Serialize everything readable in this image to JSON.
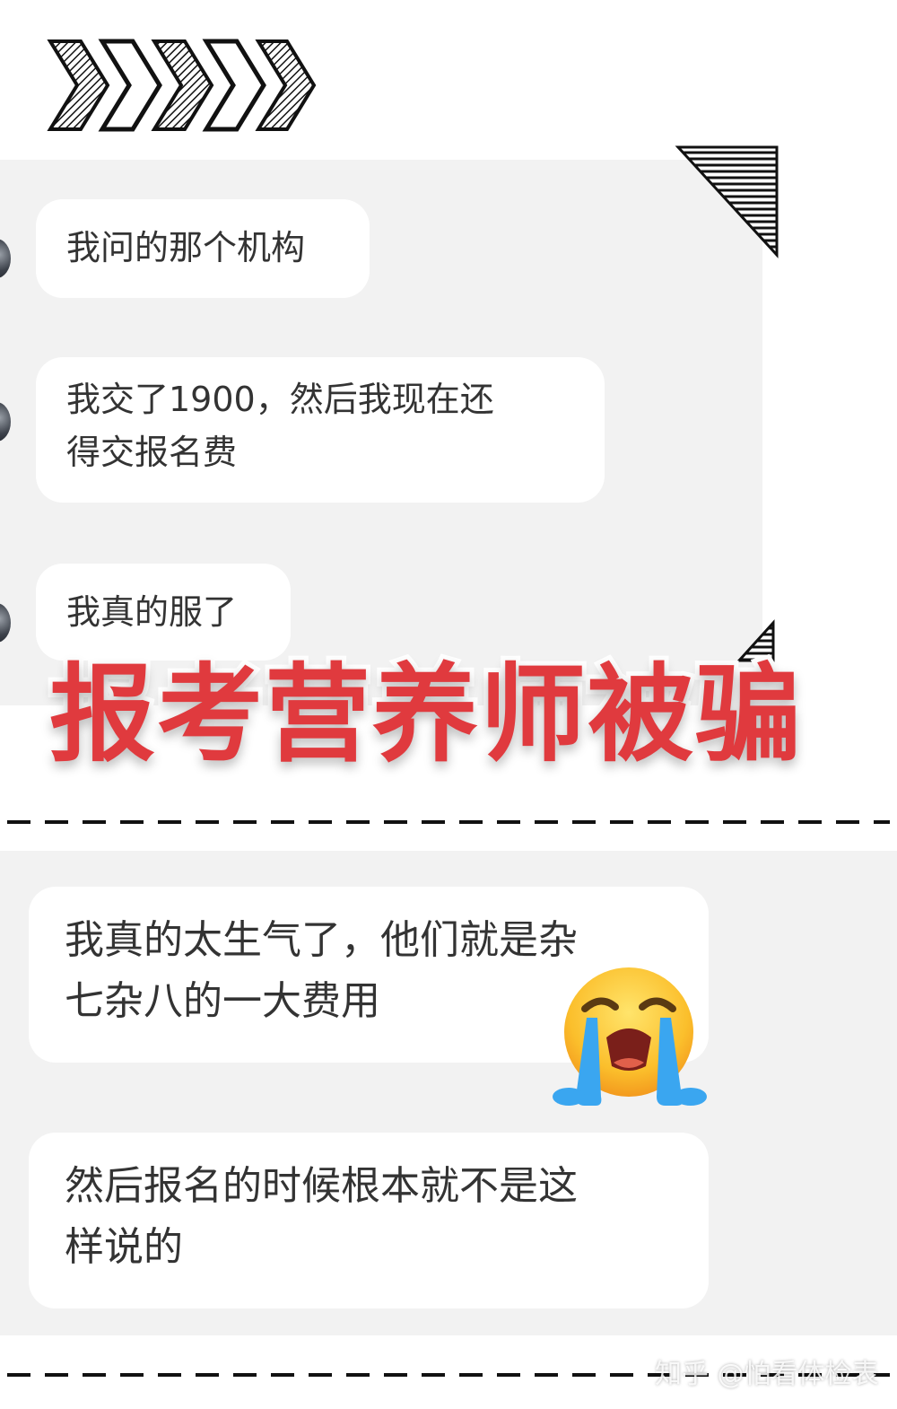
{
  "messages": [
    {
      "text": "我问的那个机构"
    },
    {
      "text": "我交了1900，然后我现在还\n得交报名费"
    },
    {
      "text": "我真的服了"
    },
    {
      "text": "我真的太生气了，他们就是杂\n七杂八的一大费用"
    },
    {
      "text": "然后报名的时候根本就不是这\n样说的"
    }
  ],
  "headline": "报考营养师被骗",
  "watermark": "知乎 @怕看体检表",
  "colors": {
    "headline": "#e03a3e",
    "panel": "#f2f2f2",
    "bubble": "#ffffff",
    "text": "#333333"
  },
  "icons": [
    "chevron-right-icon",
    "hatched-triangle-icon",
    "loudly-crying-face-icon"
  ]
}
